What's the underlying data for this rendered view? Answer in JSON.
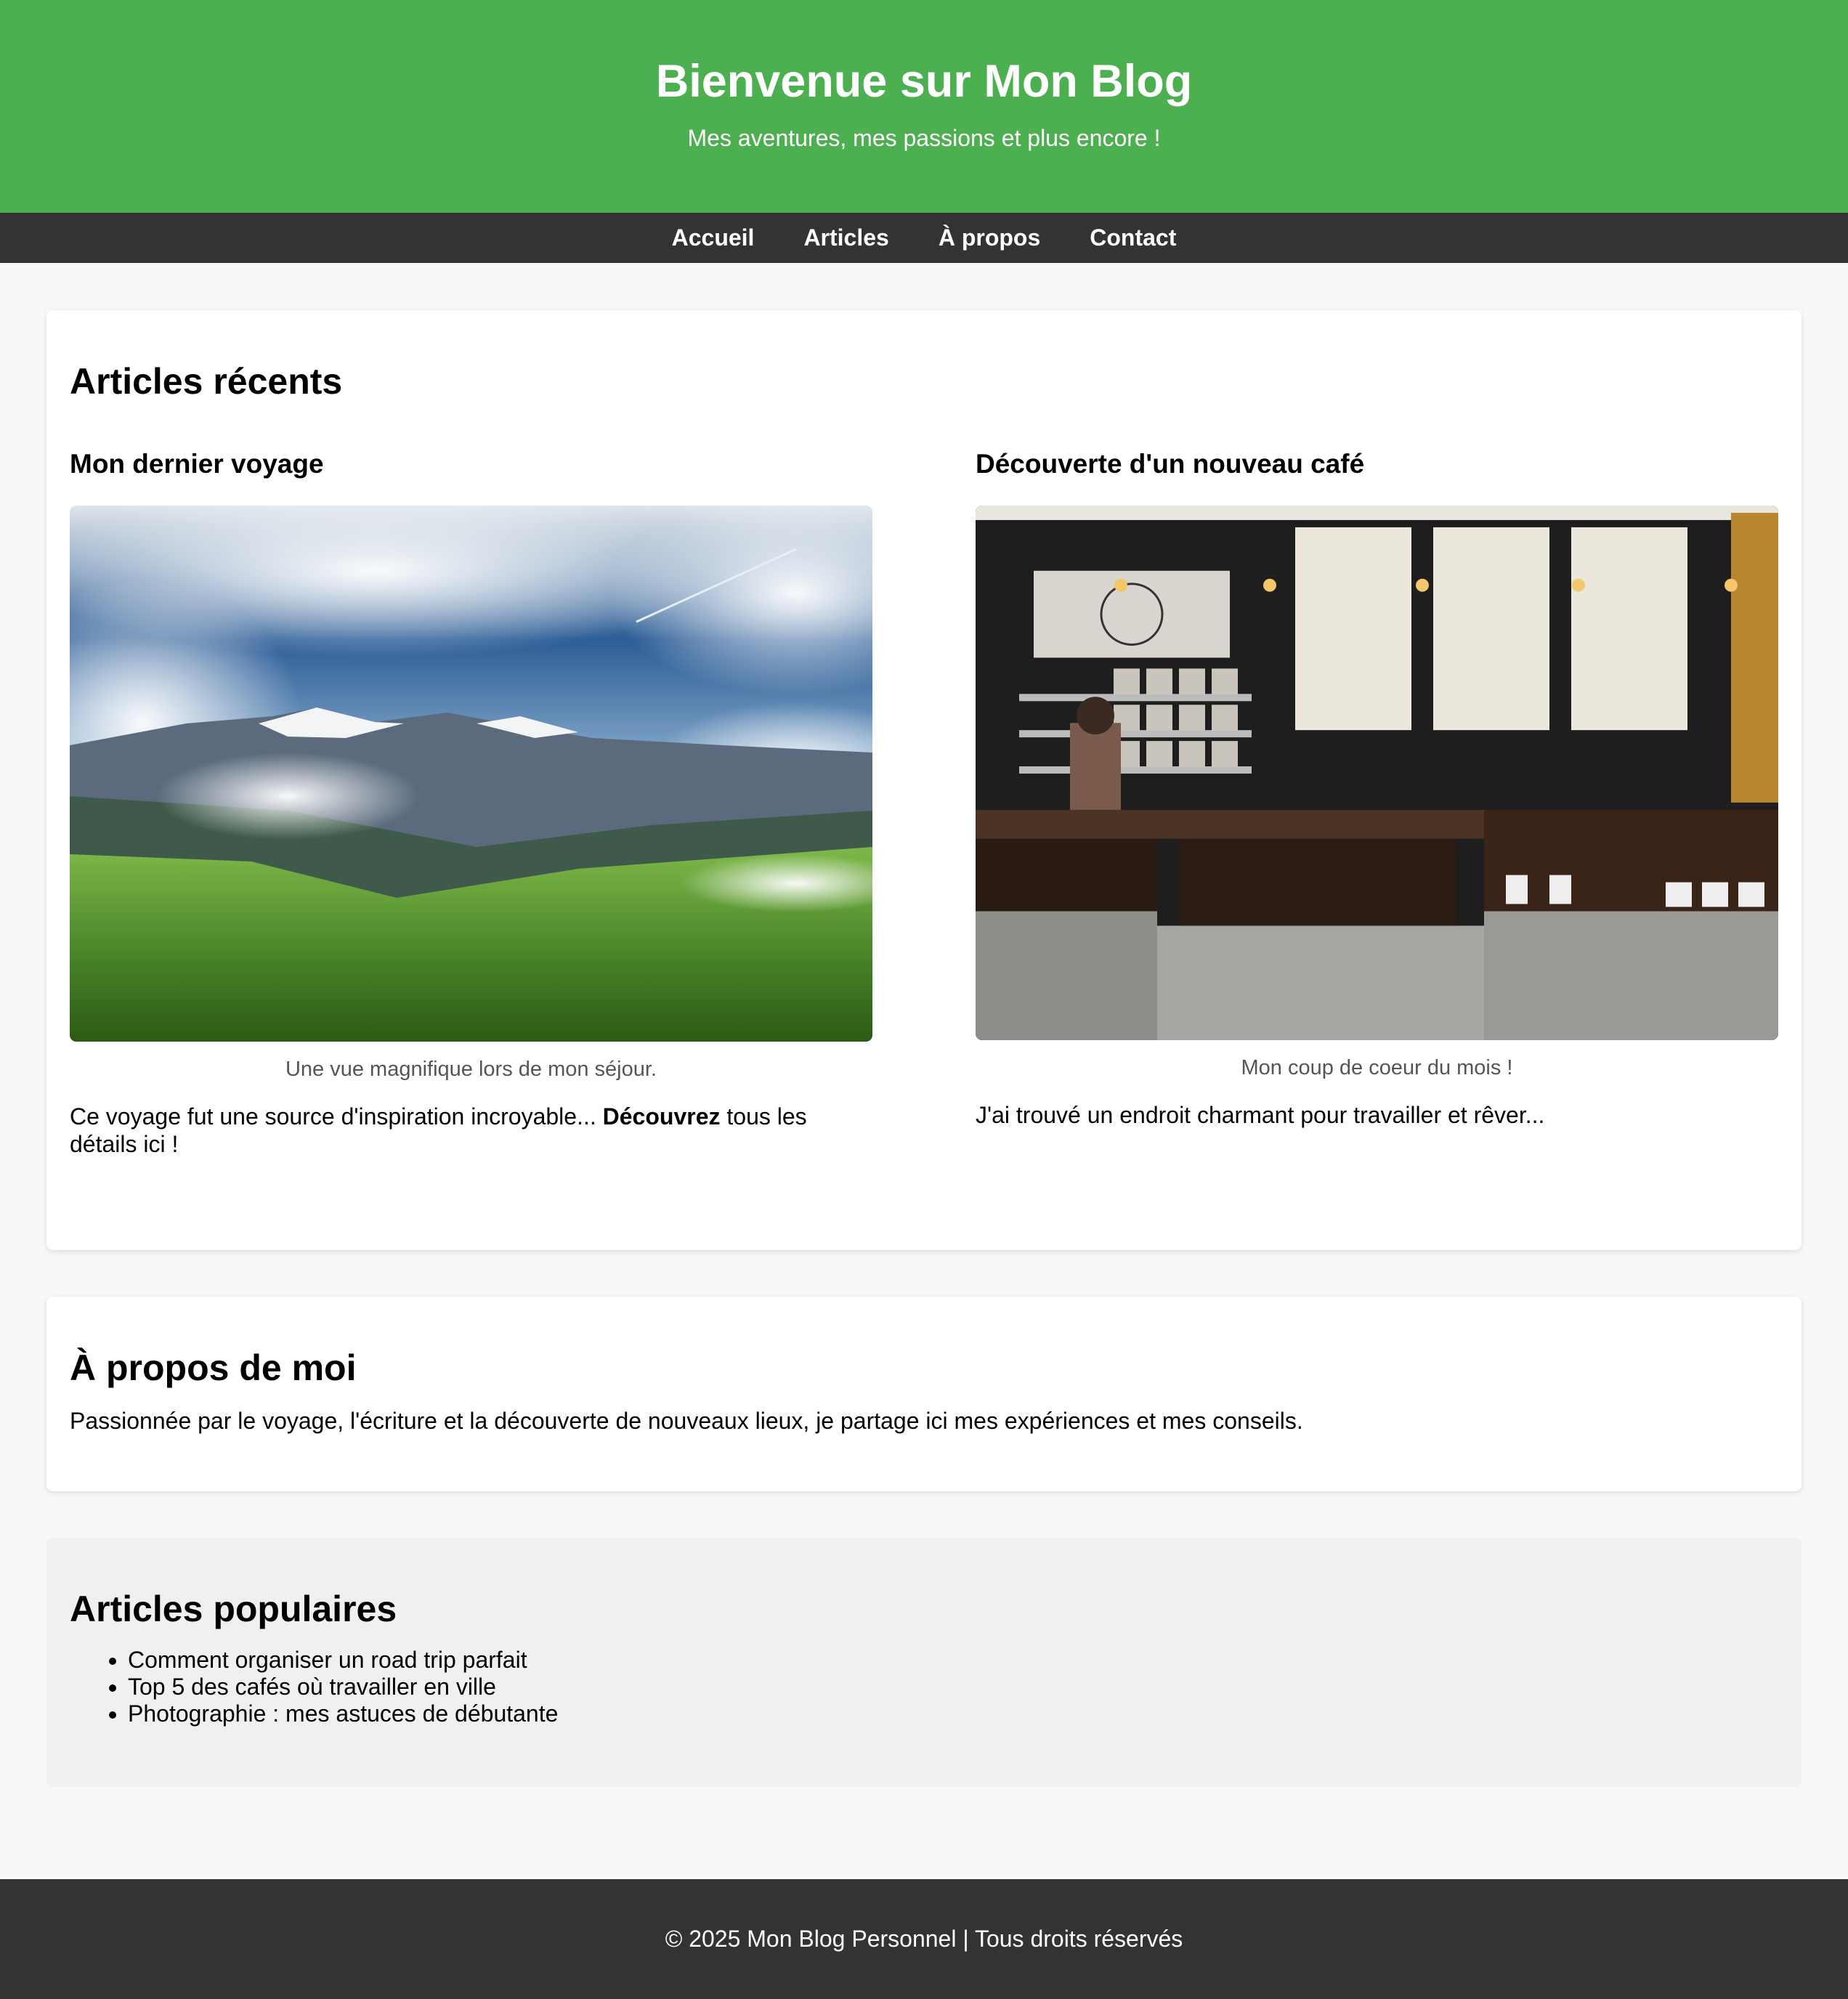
{
  "header": {
    "title": "Bienvenue sur Mon Blog",
    "tagline": "Mes aventures, mes passions et plus encore !",
    "brand_color": "#4caf50"
  },
  "nav": {
    "items": [
      "Accueil",
      "Articles",
      "À propos",
      "Contact"
    ]
  },
  "recent": {
    "heading": "Articles récents",
    "articles": [
      {
        "title": "Mon dernier voyage",
        "image": "mountain-landscape-photo",
        "caption": "Une vue magnifique lors de mon séjour.",
        "text_before": "Ce voyage fut une source d'inspiration incroyable... ",
        "text_bold": "Découvrez",
        "text_after": " tous les détails ici !"
      },
      {
        "title": "Découverte d'un nouveau café",
        "image": "coffee-shop-counter-photo",
        "caption": "Mon coup de coeur du mois !",
        "text": "J'ai trouvé un endroit charmant pour travailler et rêver..."
      }
    ]
  },
  "about": {
    "heading": "À propos de moi",
    "text": "Passionnée par le voyage, l'écriture et la découverte de nouveaux lieux, je partage ici mes expériences et mes conseils."
  },
  "popular": {
    "heading": "Articles populaires",
    "items": [
      "Comment organiser un road trip parfait",
      "Top 5 des cafés où travailler en ville",
      "Photographie : mes astuces de débutante"
    ]
  },
  "footer": {
    "text": "© 2025 Mon Blog Personnel | Tous droits réservés"
  }
}
